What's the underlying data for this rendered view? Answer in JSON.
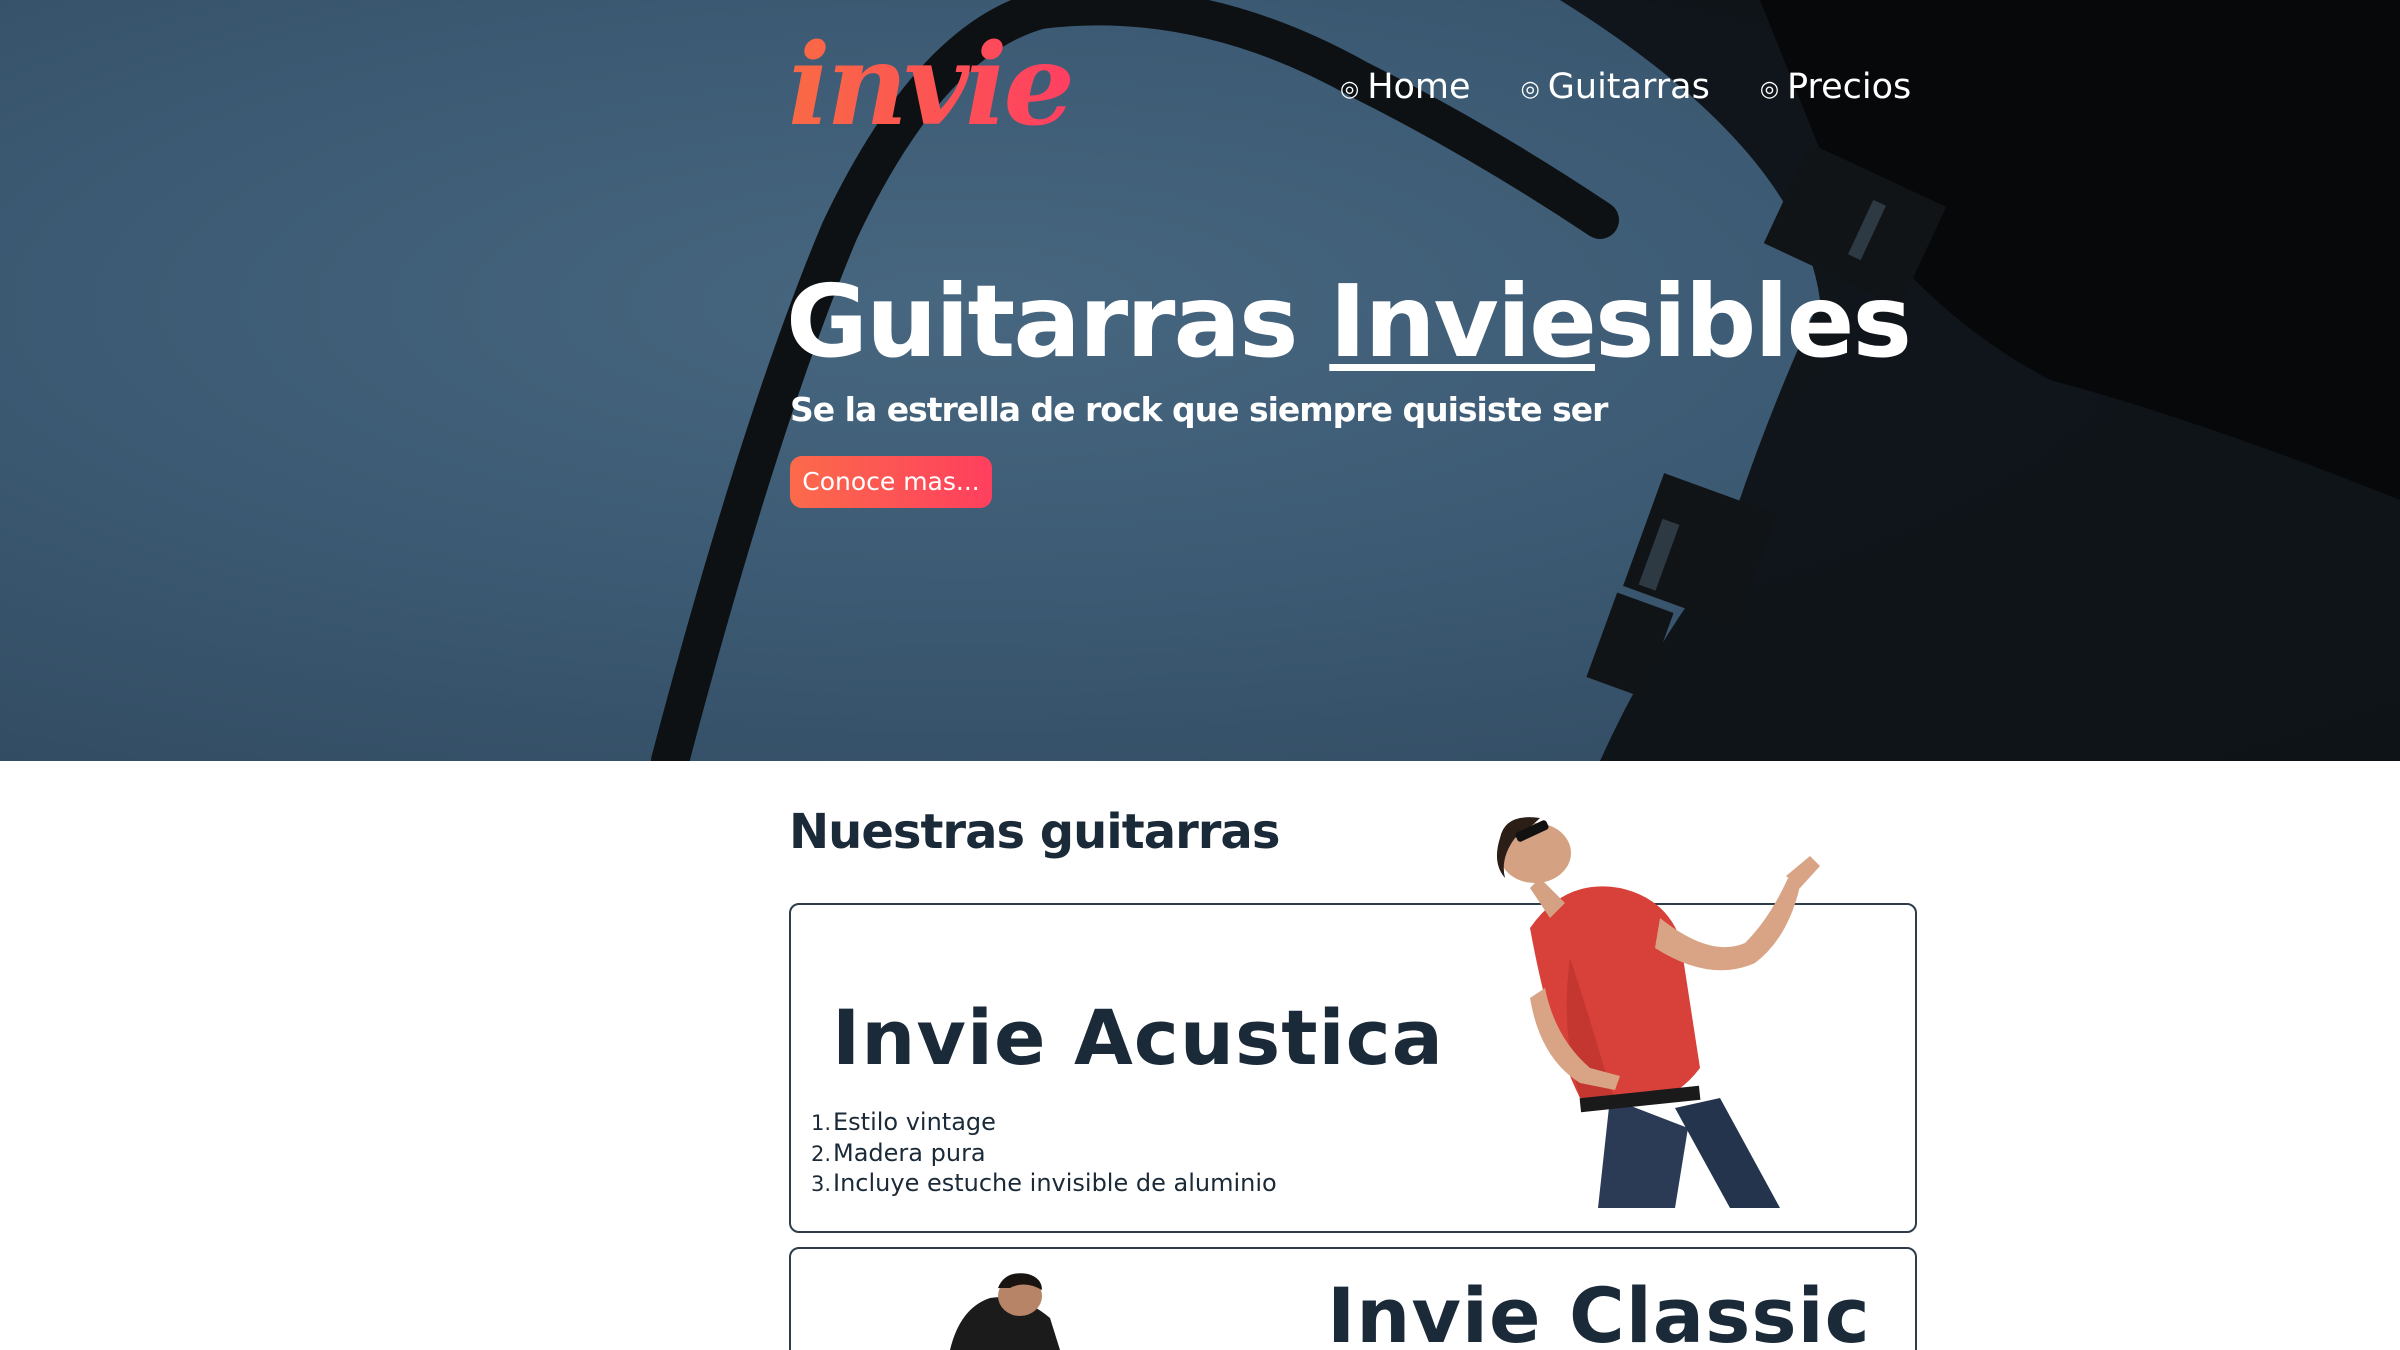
{
  "brand": {
    "logo_text": "invie",
    "accent_color": "#ff4f5a"
  },
  "nav": {
    "items": [
      {
        "label": "Home",
        "icon": "target-icon"
      },
      {
        "label": "Guitarras",
        "icon": "target-icon"
      },
      {
        "label": "Precios",
        "icon": "target-icon"
      }
    ],
    "icon_glyph": "◎"
  },
  "hero": {
    "title_part1": "Guitarras ",
    "title_underlined": "Invie",
    "title_part2": "sibles",
    "subtitle": "Se la estrella de rock que siempre quisiste ser",
    "cta_label": "Conoce mas..."
  },
  "products": {
    "section_title": "Nuestras guitarras",
    "items": [
      {
        "name": "Invie Acustica",
        "features": [
          "Estilo vintage",
          "Madera pura",
          "Incluye estuche invisible de aluminio"
        ]
      },
      {
        "name": "Invie Classic"
      }
    ]
  }
}
